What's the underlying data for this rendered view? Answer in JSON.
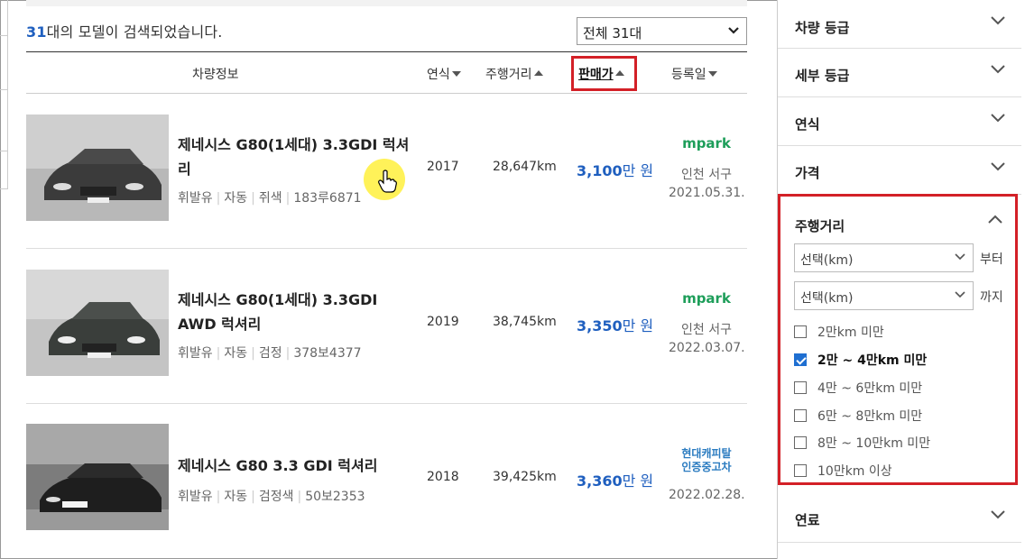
{
  "result": {
    "count": "31",
    "suffix": "대의 모델이 검색되었습니다."
  },
  "sort_select": {
    "value": "전체 31대"
  },
  "table_header": {
    "info": "차량정보",
    "year": "연식",
    "mileage": "주행거리",
    "price": "판매가",
    "registered": "등록일"
  },
  "cars": [
    {
      "name": "제네시스 G80(1세대) 3.3GDI 럭셔리",
      "fuel": "휘발유",
      "transmission": "자동",
      "color": "쥐색",
      "plate": "183루6871",
      "year": "2017",
      "mileage": "28,647km",
      "price_num": "3,100",
      "price_unit": "만 원",
      "dealer": "mpark",
      "location": "인천 서구",
      "date": "2021.05.31."
    },
    {
      "name": "제네시스 G80(1세대) 3.3GDI AWD 럭셔리",
      "fuel": "휘발유",
      "transmission": "자동",
      "color": "검정",
      "plate": "378보4377",
      "year": "2019",
      "mileage": "38,745km",
      "price_num": "3,350",
      "price_unit": "만 원",
      "dealer": "mpark",
      "location": "인천 서구",
      "date": "2022.03.07."
    },
    {
      "name": "제네시스 G80 3.3 GDI 럭셔리",
      "fuel": "휘발유",
      "transmission": "자동",
      "color": "검정색",
      "plate": "50보2353",
      "year": "2018",
      "mileage": "39,425km",
      "price_num": "3,360",
      "price_unit": "만 원",
      "dealer_line1": "현대캐피탈",
      "dealer_line2": "인증중고차",
      "location": "",
      "date": "2022.02.28."
    }
  ],
  "sidebar": {
    "grade": "차량 등급",
    "sub_grade": "세부 등급",
    "year": "연식",
    "price": "가격",
    "mileage": {
      "title": "주행거리",
      "from_placeholder": "선택(km)",
      "from_suffix": "부터",
      "to_placeholder": "선택(km)",
      "to_suffix": "까지",
      "options": [
        {
          "label": "2만km 미만",
          "checked": false
        },
        {
          "label": "2만 ~ 4만km 미만",
          "checked": true
        },
        {
          "label": "4만 ~ 6만km 미만",
          "checked": false
        },
        {
          "label": "6만 ~ 8만km 미만",
          "checked": false
        },
        {
          "label": "8만 ~ 10만km 미만",
          "checked": false
        },
        {
          "label": "10만km 이상",
          "checked": false
        }
      ]
    },
    "fuel": "연료"
  },
  "colors": {
    "accent_blue": "#1f5fbf",
    "highlight_red": "#d32027",
    "mpark_green": "#1e9e5a"
  }
}
